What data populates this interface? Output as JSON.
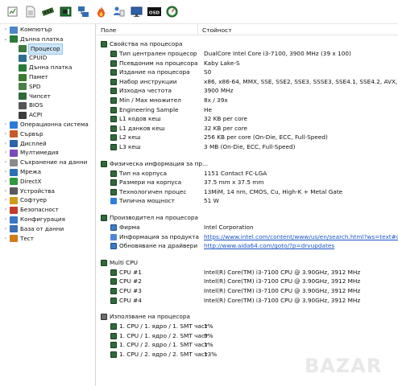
{
  "toolbar": {
    "buttons": [
      {
        "icon": "report-icon",
        "color": "#8a8a8a"
      },
      {
        "icon": "file-icon",
        "color": "#b0b0b0"
      },
      {
        "icon": "memory-module-icon",
        "color": "#3d7a2f"
      },
      {
        "icon": "motherboard-icon",
        "color": "#1b6f2e"
      },
      {
        "icon": "network-icon",
        "color": "#2f6fb5"
      },
      {
        "icon": "flame-icon",
        "color": "#e25b1b"
      },
      {
        "icon": "users-icon",
        "color": "#3a76c4"
      },
      {
        "icon": "monitor-icon",
        "color": "#2f62a8"
      },
      {
        "icon": "osd-icon",
        "color": "#c91c1c",
        "text": "OSD"
      },
      {
        "icon": "gauge-icon",
        "color": "#2e8a3a"
      }
    ]
  },
  "sidebar": {
    "items": [
      {
        "label": "Компютър",
        "arrow": "›",
        "icon": "computer-icon"
      },
      {
        "label": "Дънна платка",
        "arrow": "⌄",
        "icon": "motherboard-icon"
      },
      {
        "label": "Процесор",
        "arrow": "",
        "icon": "cpu-icon",
        "selected": true
      },
      {
        "label": "CPUID",
        "arrow": "",
        "icon": "cpuid-icon"
      },
      {
        "label": "Дънна платка",
        "arrow": "",
        "icon": "board-icon"
      },
      {
        "label": "Памет",
        "arrow": "",
        "icon": "memory-icon"
      },
      {
        "label": "SPD",
        "arrow": "",
        "icon": "spd-icon"
      },
      {
        "label": "Чипсет",
        "arrow": "",
        "icon": "chipset-icon"
      },
      {
        "label": "BIOS",
        "arrow": "",
        "icon": "bios-icon"
      },
      {
        "label": "ACPI",
        "arrow": "",
        "icon": "acpi-icon"
      },
      {
        "label": "Операционна система",
        "arrow": "›",
        "icon": "windows-icon"
      },
      {
        "label": "Сървър",
        "arrow": "›",
        "icon": "server-icon"
      },
      {
        "label": "Дисплей",
        "arrow": "›",
        "icon": "display-icon"
      },
      {
        "label": "Мултимедия",
        "arrow": "›",
        "icon": "multimedia-icon"
      },
      {
        "label": "Съхранение на данни",
        "arrow": "›",
        "icon": "storage-icon"
      },
      {
        "label": "Мрежа",
        "arrow": "›",
        "icon": "network-icon"
      },
      {
        "label": "DirectX",
        "arrow": "›",
        "icon": "directx-icon"
      },
      {
        "label": "Устройства",
        "arrow": "›",
        "icon": "devices-icon"
      },
      {
        "label": "Софтуер",
        "arrow": "›",
        "icon": "software-icon"
      },
      {
        "label": "Безопасност",
        "arrow": "›",
        "icon": "security-icon"
      },
      {
        "label": "Конфигурация",
        "arrow": "›",
        "icon": "config-icon"
      },
      {
        "label": "База от данни",
        "arrow": "›",
        "icon": "database-icon"
      },
      {
        "label": "Тест",
        "arrow": "›",
        "icon": "test-icon"
      }
    ]
  },
  "table": {
    "header_field": "Поле",
    "header_value": "Стойност",
    "sections": [
      {
        "title": "Свойства на процесора",
        "rows": [
          {
            "name": "Тип централен процесор",
            "value": "DualCore Intel Core i3-7100, 3900 MHz (39 x 100)"
          },
          {
            "name": "Псевдоним на процесора",
            "value": "Kaby Lake-S"
          },
          {
            "name": "Издание на процесора",
            "value": "S0"
          },
          {
            "name": "Набор инструкции",
            "value": "x86, x86-64, MMX, SSE, SSE2, SSE3, SSSE3, SSE4.1, SSE4.2, AVX, AVX2, F..."
          },
          {
            "name": "Изходна честота",
            "value": "3900 MHz"
          },
          {
            "name": "Min / Max множител",
            "value": "8x / 39x"
          },
          {
            "name": "Engineering Sample",
            "value": "Не"
          },
          {
            "name": "L1 кодов кеш",
            "value": "32 KB per core"
          },
          {
            "name": "L1 данков кеш",
            "value": "32 KB per core"
          },
          {
            "name": "L2 кеш",
            "value": "256 KB per core  (On-Die, ECC, Full-Speed)"
          },
          {
            "name": "L3 кеш",
            "value": "3 MB  (On-Die, ECC, Full-Speed)"
          }
        ]
      },
      {
        "title": "Физическа информация за пр...",
        "rows": [
          {
            "name": "Тип на корпуса",
            "value": "1151 Contact FC-LGA"
          },
          {
            "name": "Размери на корпуса",
            "value": "37.5 mm x 37.5 mm"
          },
          {
            "name": "Технологичен процес",
            "value": "13MiM, 14 nm, CMOS, Cu, High-K + Metal Gate"
          },
          {
            "name": "Типична мощност",
            "value": "51 W"
          }
        ]
      },
      {
        "title": "Производител на процесора",
        "rows": [
          {
            "name": "Фирма",
            "value": "Intel Corporation"
          },
          {
            "name": "Информация за продукта",
            "value": "https://www.intel.com/content/www/us/en/search.html?ws=text#q...",
            "link": true
          },
          {
            "name": "Обновяване на драйвери",
            "value": "http://www.aida64.com/goto/?p=drvupdates",
            "link": true
          }
        ]
      },
      {
        "title": "Multi CPU",
        "rows": [
          {
            "name": "CPU #1",
            "value": "Intel(R) Core(TM) i3-7100 CPU @ 3.90GHz, 3912 MHz"
          },
          {
            "name": "CPU #2",
            "value": "Intel(R) Core(TM) i3-7100 CPU @ 3.90GHz, 3912 MHz"
          },
          {
            "name": "CPU #3",
            "value": "Intel(R) Core(TM) i3-7100 CPU @ 3.90GHz, 3912 MHz"
          },
          {
            "name": "CPU #4",
            "value": "Intel(R) Core(TM) i3-7100 CPU @ 3.90GHz, 3912 MHz"
          }
        ]
      },
      {
        "title": "Използване на процесора",
        "rows": [
          {
            "name": "1. CPU / 1. ядро / 1. SMT част",
            "value": "1%"
          },
          {
            "name": "1. CPU / 1. ядро / 2. SMT част",
            "value": "0%"
          },
          {
            "name": "1. CPU / 2. ядро / 1. SMT част",
            "value": "1%"
          },
          {
            "name": "1. CPU / 2. ядро / 2. SMT част",
            "value": "13%"
          }
        ]
      }
    ]
  },
  "watermark": "BAZAR"
}
